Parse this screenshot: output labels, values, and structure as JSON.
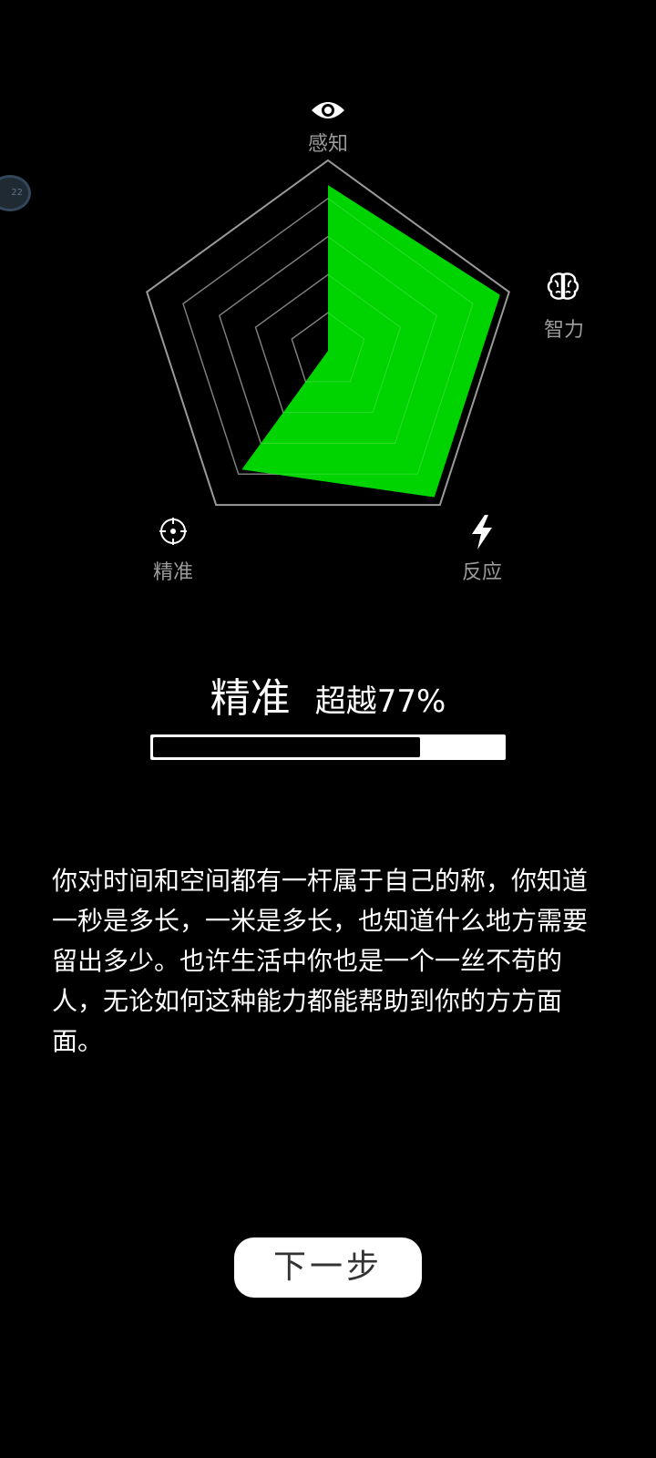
{
  "radar": {
    "axes": [
      {
        "label": "感知",
        "icon": "eye-icon",
        "value": 0.87
      },
      {
        "label": "智力",
        "icon": "brain-icon",
        "value": 0.95
      },
      {
        "label": "反应",
        "icon": "lightning-icon",
        "value": 0.95
      },
      {
        "label": "精准",
        "icon": "crosshair-icon",
        "value": 0.77
      },
      {
        "label": "感知",
        "icon": "",
        "value": 0.0
      }
    ],
    "fill_color": "#00d400",
    "grid_color": "#8a8a8a"
  },
  "side_badge": {
    "text": "22"
  },
  "result": {
    "attribute": "精准",
    "beat_text": "超越77%",
    "progress": 0.77
  },
  "description": "你对时间和空间都有一杆属于自己的称，你知道一秒是多长，一米是多长，也知道什么地方需要留出多少。也许生活中你也是一个一丝不苟的人，无论如何这种能力都能帮助到你的方方面面。",
  "next_button": {
    "label": "下一步"
  }
}
